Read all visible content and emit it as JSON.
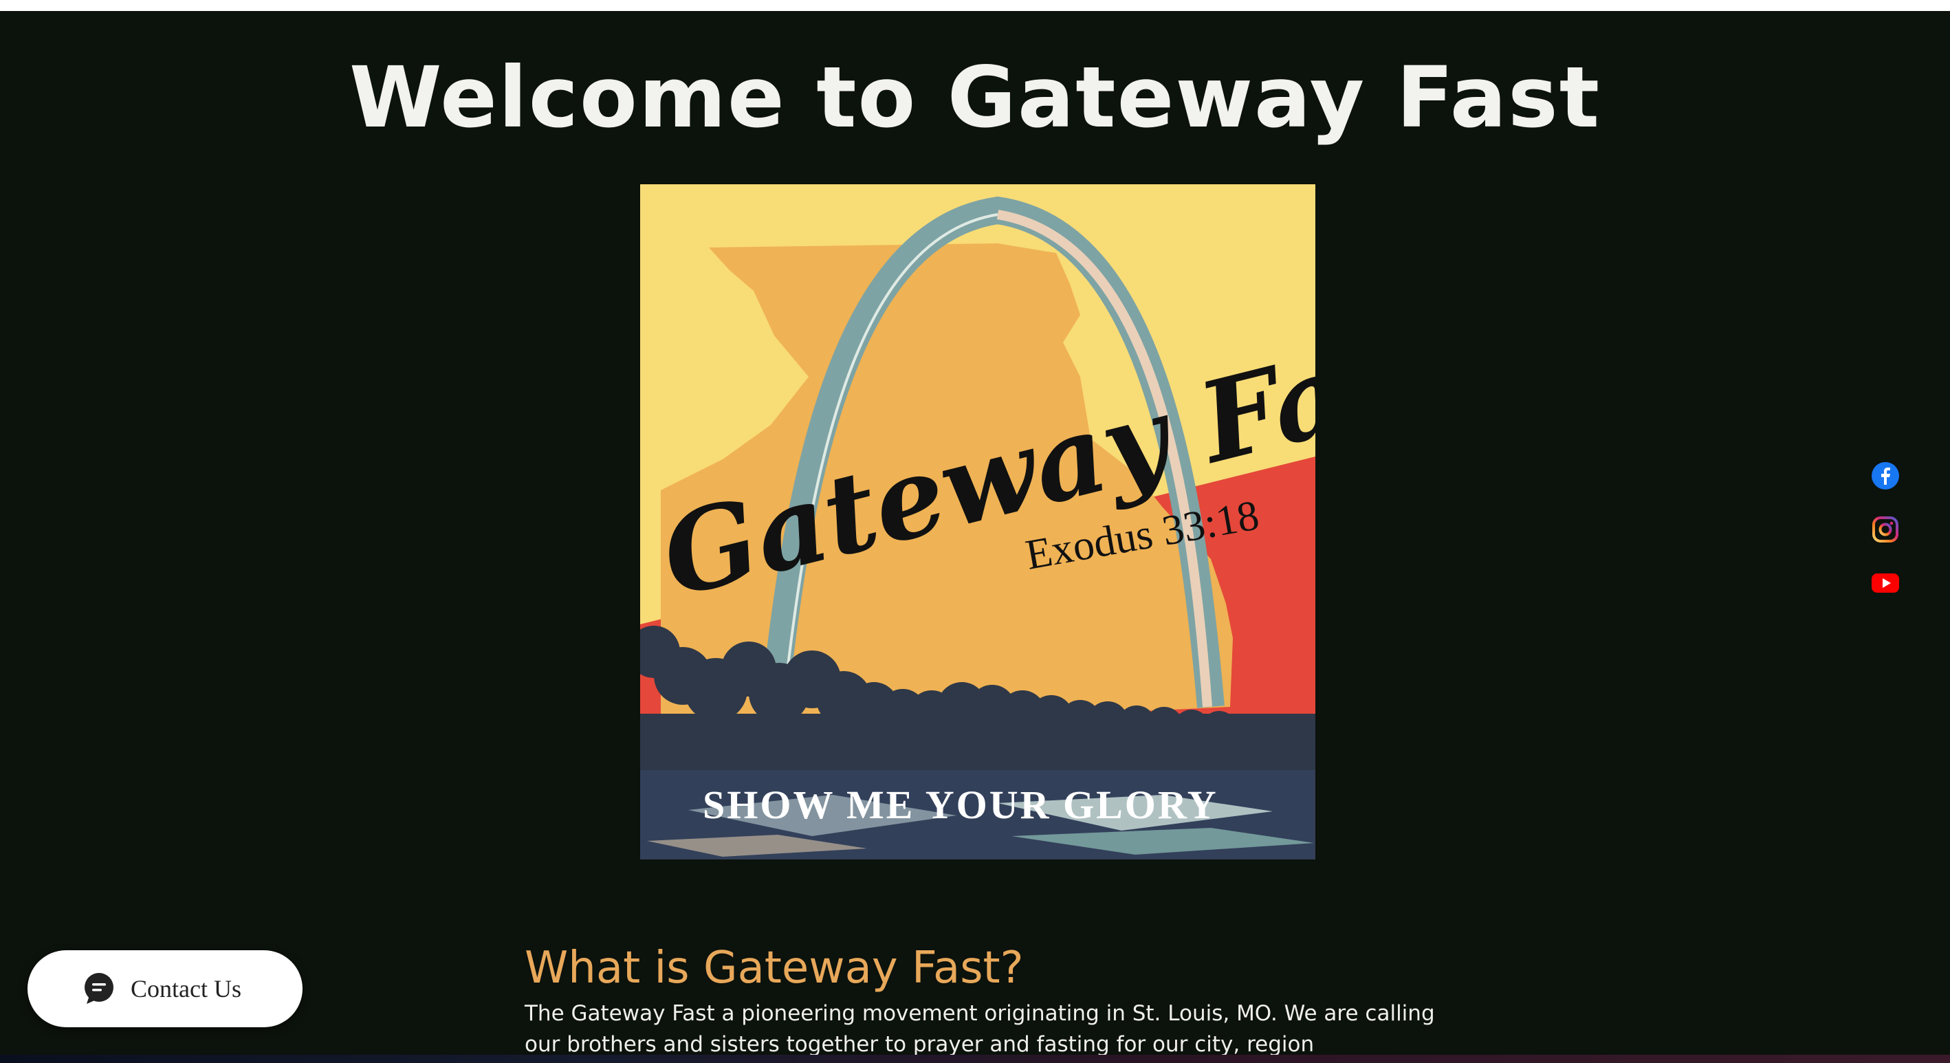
{
  "hero": {
    "title": "Welcome to Gateway Fast"
  },
  "banner": {
    "logo_title": "Gateway Fast",
    "scripture": "Exodus 33:18",
    "tagline": "SHOW ME YOUR GLORY",
    "colors": {
      "sky": "#f8dc76",
      "state": "#efb254",
      "band": "#e5473a",
      "arch": "#7ea3a4",
      "trees": "#2e3848",
      "water": "#cfe1dc"
    }
  },
  "social": {
    "items": [
      {
        "icon": "facebook-icon",
        "color": "#1877f2"
      },
      {
        "icon": "instagram-icon",
        "color": "#d6249f"
      },
      {
        "icon": "youtube-icon",
        "color": "#ff0000"
      }
    ]
  },
  "about": {
    "title": "What is Gateway Fast?",
    "body": "The Gateway Fast a pioneering movement originating in St. Louis, MO.  We are calling our brothers and sisters together to prayer and fasting for our city, region"
  },
  "contact": {
    "label": "Contact Us",
    "icon": "chat-bubble-icon"
  }
}
